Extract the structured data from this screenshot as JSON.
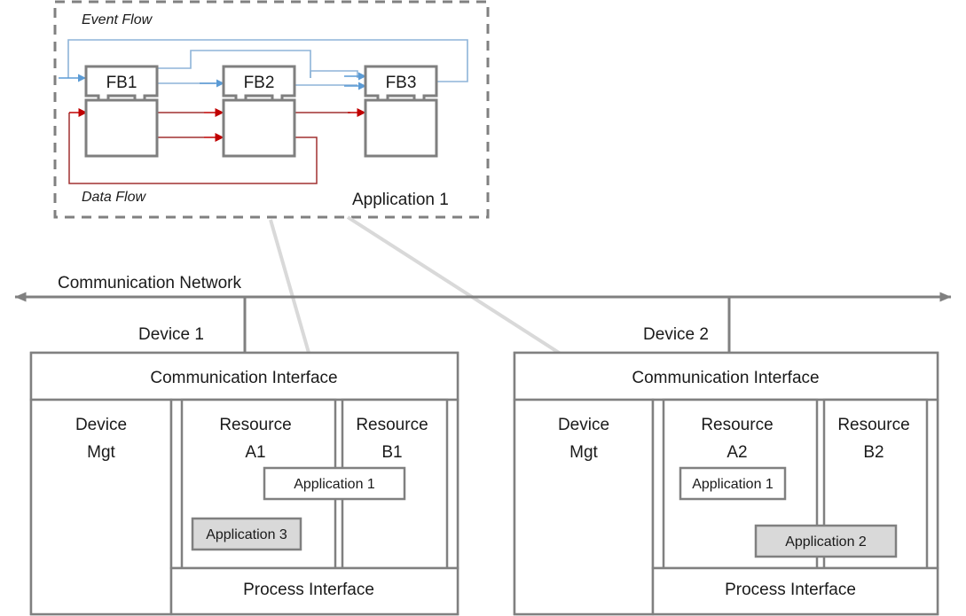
{
  "application_block": {
    "label": "Application 1",
    "event_flow_label": "Event Flow",
    "data_flow_label": "Data Flow",
    "function_blocks": [
      {
        "name": "FB1"
      },
      {
        "name": "FB2"
      },
      {
        "name": "FB3"
      }
    ],
    "border_style": "dashed",
    "border_color": "#808080"
  },
  "network": {
    "label": "Communication Network",
    "arrow_color": "#808080"
  },
  "colors": {
    "event_flow": "#8eb4d8",
    "event_arrow": "#5b9bd5",
    "data_flow": "#a03030",
    "data_arrow": "#c00000",
    "fb_border": "#7f7f7f",
    "box_border": "#808080",
    "shaded_fill": "#d9d9d9",
    "pointer": "#d9d9d9",
    "text": "#1a1a1a"
  },
  "devices": [
    {
      "label": "Device 1",
      "communication_interface": "Communication Interface",
      "device_mgt": "Device\nMgt",
      "device_mgt_line1": "Device",
      "device_mgt_line2": "Mgt",
      "process_interface": "Process Interface",
      "resources": [
        {
          "line1": "Resource",
          "line2": "A1"
        },
        {
          "line1": "Resource",
          "line2": "B1"
        }
      ],
      "applications": [
        {
          "label": "Application 1",
          "shaded": false
        },
        {
          "label": "Application 3",
          "shaded": true
        }
      ]
    },
    {
      "label": "Device 2",
      "communication_interface": "Communication Interface",
      "device_mgt_line1": "Device",
      "device_mgt_line2": "Mgt",
      "process_interface": "Process Interface",
      "resources": [
        {
          "line1": "Resource",
          "line2": "A2"
        },
        {
          "line1": "Resource",
          "line2": "B2"
        }
      ],
      "applications": [
        {
          "label": "Application 1",
          "shaded": false
        },
        {
          "label": "Application 2",
          "shaded": true
        }
      ]
    }
  ],
  "mapping_arrows": [
    {
      "from": "application-1-block",
      "to": "device-1-resource-a1"
    },
    {
      "from": "application-1-block",
      "to": "device-2-resource-a2"
    }
  ]
}
